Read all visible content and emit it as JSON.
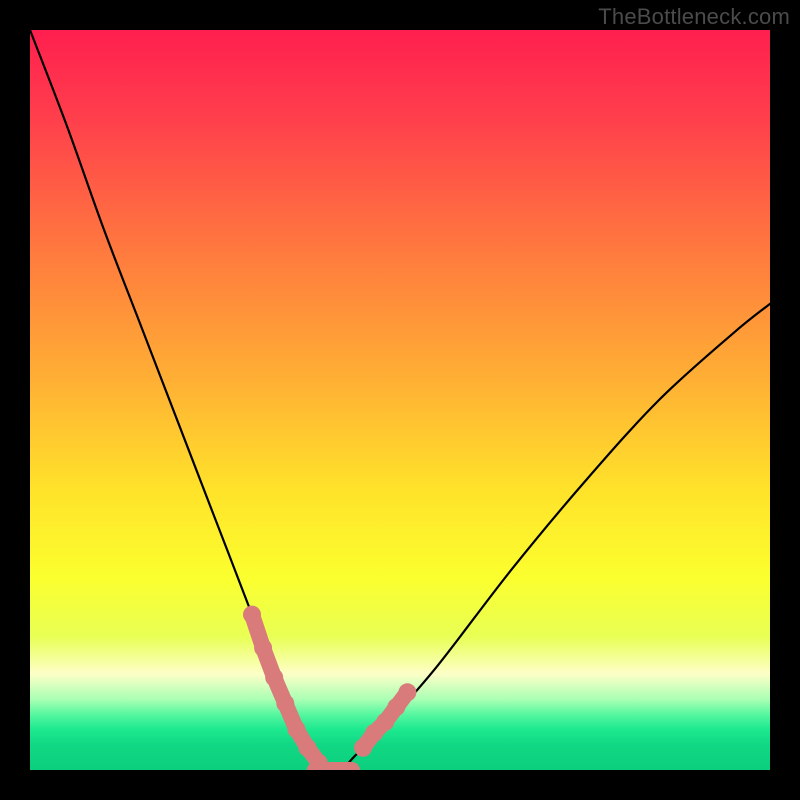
{
  "watermark": "TheBottleneck.com",
  "chart_data": {
    "type": "line",
    "title": "",
    "xlabel": "",
    "ylabel": "",
    "xlim": [
      0,
      100
    ],
    "ylim": [
      0,
      100
    ],
    "grid": false,
    "series": [
      {
        "name": "bottleneck-curve",
        "x": [
          0,
          5,
          10,
          15,
          20,
          25,
          30,
          34,
          36,
          38,
          40,
          42,
          44,
          48,
          55,
          65,
          75,
          85,
          95,
          100
        ],
        "y": [
          100,
          87,
          73,
          60,
          47,
          34,
          21,
          10,
          5,
          2,
          0,
          0,
          2,
          6,
          14,
          27,
          39,
          50,
          59,
          63
        ]
      }
    ],
    "markers": [
      {
        "name": "left-marker-segment",
        "color": "#d97b7b",
        "x": [
          30,
          31.5,
          33,
          34.5,
          36,
          37.5,
          39
        ],
        "y": [
          21,
          16.5,
          12.5,
          9,
          5.5,
          3,
          1
        ]
      },
      {
        "name": "right-marker-segment",
        "color": "#d97b7b",
        "x": [
          45,
          46.5,
          48,
          49.5,
          51
        ],
        "y": [
          3,
          5,
          6.5,
          8.5,
          10.5
        ]
      }
    ],
    "background_gradient": {
      "stops": [
        {
          "offset": 0.0,
          "color": "#ff1f4f"
        },
        {
          "offset": 0.12,
          "color": "#ff3f4c"
        },
        {
          "offset": 0.3,
          "color": "#ff7a3e"
        },
        {
          "offset": 0.48,
          "color": "#ffb234"
        },
        {
          "offset": 0.62,
          "color": "#ffe22a"
        },
        {
          "offset": 0.74,
          "color": "#fbff2e"
        },
        {
          "offset": 0.82,
          "color": "#e8ff55"
        },
        {
          "offset": 0.87,
          "color": "#fdffc8"
        },
        {
          "offset": 0.905,
          "color": "#a8ffb3"
        },
        {
          "offset": 0.925,
          "color": "#56f7a0"
        },
        {
          "offset": 0.945,
          "color": "#1de98f"
        },
        {
          "offset": 0.965,
          "color": "#11d884"
        },
        {
          "offset": 1.0,
          "color": "#0ccf7d"
        }
      ]
    }
  }
}
